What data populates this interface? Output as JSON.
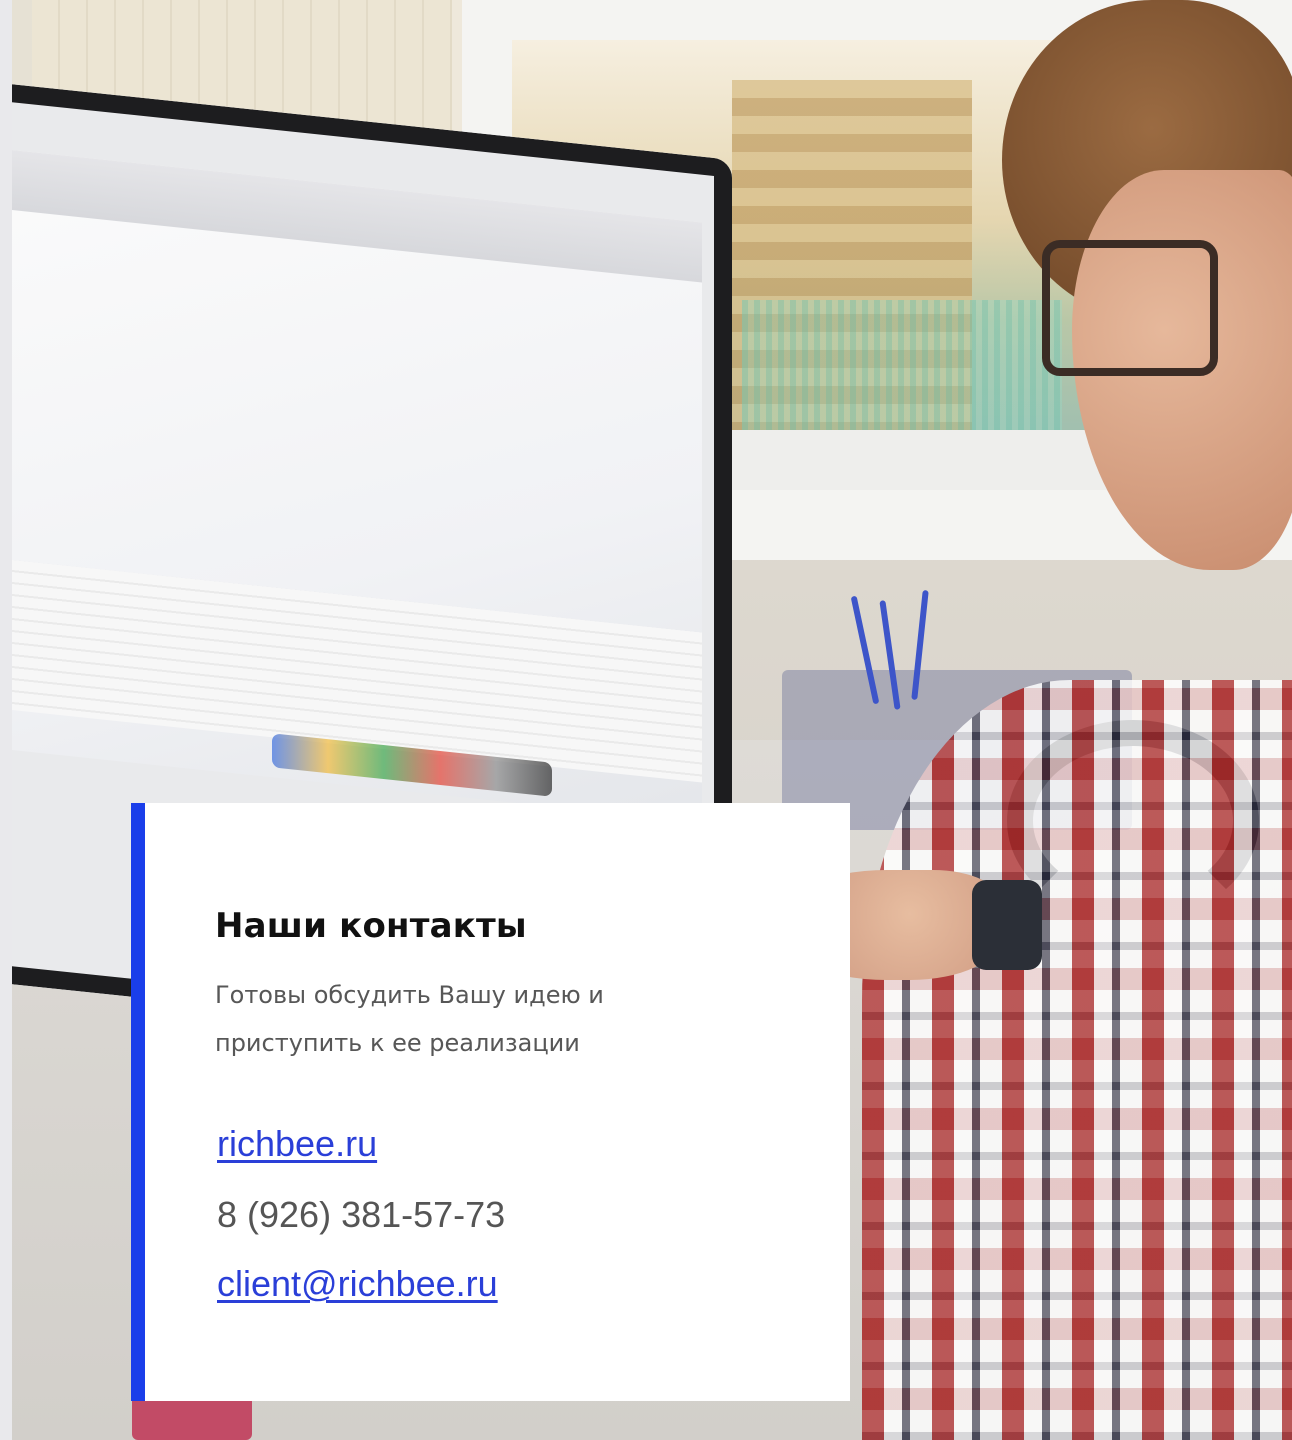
{
  "contacts": {
    "title": "Наши контакты",
    "subtitle_line1": "Готовы обсудить Вашу идею и",
    "subtitle_line2": "приступить к ее реализации",
    "website": "richbee.ru",
    "phone": "8 (926) 381-57-73",
    "email": "client@richbee.ru"
  },
  "colors": {
    "accent": "#1a3eea",
    "link": "#2a3fd8",
    "card_background": "#ffffff",
    "title": "#111111",
    "body_text": "#575757"
  },
  "background_photo": {
    "description_icon": "office-photo"
  }
}
